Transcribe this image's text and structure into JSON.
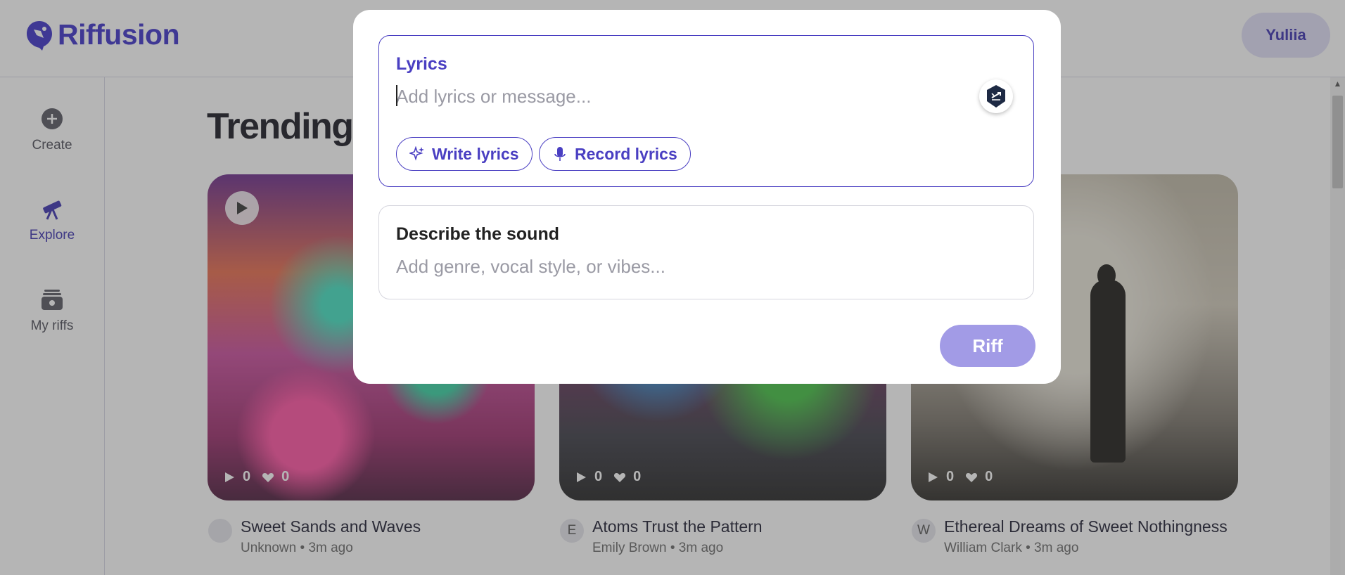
{
  "header": {
    "brand": "Riffusion",
    "user_name": "Yuliia"
  },
  "sidebar": {
    "items": [
      {
        "label": "Create",
        "icon": "plus-circle-icon"
      },
      {
        "label": "Explore",
        "icon": "telescope-icon",
        "active": true
      },
      {
        "label": "My riffs",
        "icon": "library-icon"
      }
    ]
  },
  "main": {
    "title": "Trending r",
    "cards": [
      {
        "title": "Sweet Sands and Waves",
        "author": "Unknown",
        "time": "3m ago",
        "plays": "0",
        "likes": "0",
        "avatar": "",
        "separator": "•"
      },
      {
        "title": "Atoms Trust the Pattern",
        "author": "Emily Brown",
        "time": "3m ago",
        "plays": "0",
        "likes": "0",
        "avatar": "E",
        "separator": "•"
      },
      {
        "title": "Ethereal Dreams of Sweet Nothingness",
        "author": "William Clark",
        "time": "3m ago",
        "plays": "0",
        "likes": "0",
        "avatar": "W",
        "separator": "•"
      }
    ]
  },
  "modal": {
    "lyrics": {
      "label": "Lyrics",
      "placeholder": "Add lyrics or message...",
      "value": ""
    },
    "chips": {
      "write": "Write lyrics",
      "record": "Record lyrics"
    },
    "sound": {
      "label": "Describe the sound",
      "placeholder": "Add genre, vocal style, or vibes...",
      "value": ""
    },
    "submit": "Riff"
  },
  "colors": {
    "accent": "#4a3fc2",
    "brand": "#3b2fc9",
    "riff_button": "#a29be6",
    "overlay": "rgba(70,70,70,0.40)"
  }
}
